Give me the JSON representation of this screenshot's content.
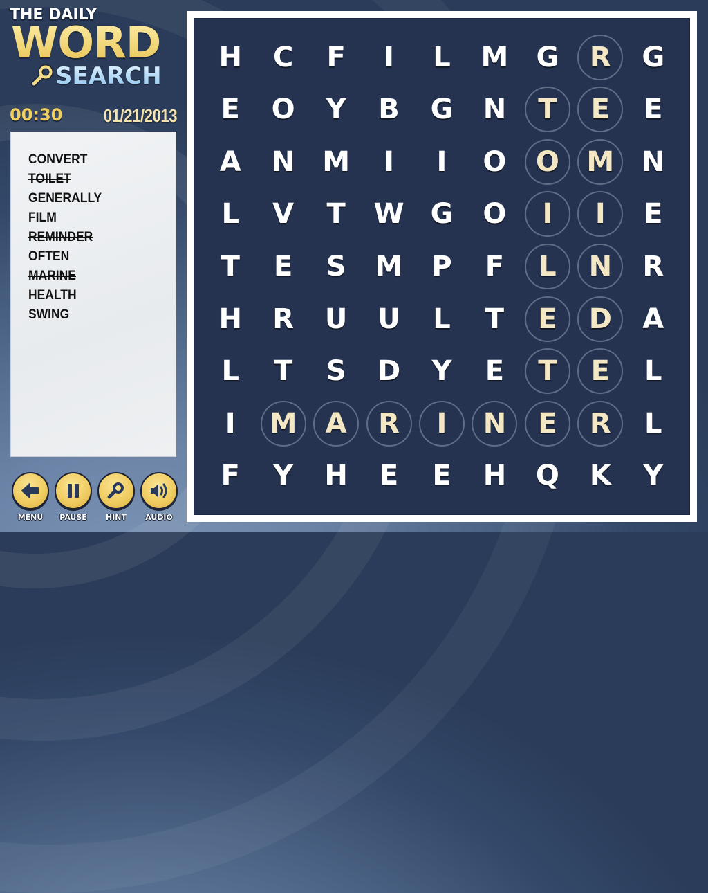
{
  "app": {
    "logo": {
      "line1": "THE DAILY",
      "line2": "WORD",
      "line3": "SEARCH",
      "icon": "key-icon"
    },
    "timer": "00:30",
    "date": "01/21/2013"
  },
  "word_list": [
    {
      "word": "CONVERT",
      "found": false
    },
    {
      "word": "TOILET",
      "found": true
    },
    {
      "word": "GENERALLY",
      "found": false
    },
    {
      "word": "FILM",
      "found": false
    },
    {
      "word": "REMINDER",
      "found": true
    },
    {
      "word": "OFTEN",
      "found": false
    },
    {
      "word": "MARINE",
      "found": true
    },
    {
      "word": "HEALTH",
      "found": false
    },
    {
      "word": "SWING",
      "found": false
    }
  ],
  "controls": [
    {
      "id": "menu",
      "label": "MENU",
      "icon": "back-arrow-icon"
    },
    {
      "id": "pause",
      "label": "PAUSE",
      "icon": "pause-icon"
    },
    {
      "id": "hint",
      "label": "HINT",
      "icon": "magnifier-icon"
    },
    {
      "id": "audio",
      "label": "AUDIO",
      "icon": "speaker-icon"
    }
  ],
  "grid": [
    [
      "H",
      "C",
      "F",
      "I",
      "L",
      "M",
      "G",
      "R",
      "G"
    ],
    [
      "E",
      "O",
      "Y",
      "B",
      "G",
      "N",
      "T",
      "E",
      "E"
    ],
    [
      "A",
      "N",
      "M",
      "I",
      "I",
      "O",
      "O",
      "M",
      "N"
    ],
    [
      "L",
      "V",
      "T",
      "W",
      "G",
      "O",
      "I",
      "I",
      "E"
    ],
    [
      "T",
      "E",
      "S",
      "M",
      "P",
      "F",
      "L",
      "N",
      "R"
    ],
    [
      "H",
      "R",
      "U",
      "U",
      "L",
      "T",
      "E",
      "D",
      "A"
    ],
    [
      "L",
      "T",
      "S",
      "D",
      "Y",
      "E",
      "T",
      "E",
      "L"
    ],
    [
      "I",
      "M",
      "A",
      "R",
      "I",
      "N",
      "E",
      "R",
      "L"
    ],
    [
      "F",
      "Y",
      "H",
      "E",
      "E",
      "H",
      "Q",
      "K",
      "Y"
    ]
  ],
  "highlighted_cells": [
    [
      0,
      7
    ],
    [
      1,
      6
    ],
    [
      1,
      7
    ],
    [
      2,
      6
    ],
    [
      2,
      7
    ],
    [
      3,
      6
    ],
    [
      3,
      7
    ],
    [
      4,
      6
    ],
    [
      4,
      7
    ],
    [
      5,
      6
    ],
    [
      5,
      7
    ],
    [
      6,
      6
    ],
    [
      6,
      7
    ],
    [
      7,
      1
    ],
    [
      7,
      2
    ],
    [
      7,
      3
    ],
    [
      7,
      4
    ],
    [
      7,
      5
    ],
    [
      7,
      6
    ],
    [
      7,
      7
    ]
  ],
  "colors": {
    "board_bg": "#263350",
    "found_letter": "#f3e7c4",
    "button_gold": "#f0cd62",
    "timer": "#f0cf5e"
  }
}
